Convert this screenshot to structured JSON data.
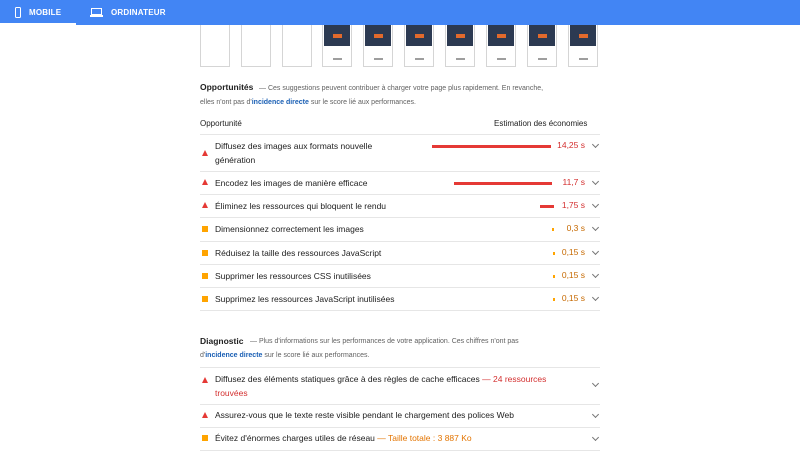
{
  "tabs": {
    "mobile": {
      "label": "MOBILE",
      "icon": "phone-icon"
    },
    "desktop": {
      "label": "ORDINATEUR",
      "icon": "laptop-icon"
    }
  },
  "colors": {
    "header": "#4285f4",
    "fail": "#e53935",
    "average": "#ffa400"
  },
  "opportunities": {
    "title": "Opportunités",
    "desc_1": "— Ces suggestions peuvent contribuer à charger votre page plus rapidement. En revanche,",
    "desc_2a": "elles n'ont pas d'",
    "desc_link": "incidence directe",
    "desc_2b": " sur le score lié aux performances.",
    "col_opportunity": "Opportunité",
    "col_savings": "Estimation des économies",
    "items": [
      {
        "label": "Diffusez des images aux formats nouvelle génération",
        "value": "14,25 s",
        "status": "fail",
        "savings_s": 14.25
      },
      {
        "label": "Encodez les images de manière efficace",
        "value": "11,7 s",
        "status": "fail",
        "savings_s": 11.7
      },
      {
        "label": "Éliminez les ressources qui bloquent le rendu",
        "value": "1,75 s",
        "status": "fail",
        "savings_s": 1.75
      },
      {
        "label": "Dimensionnez correctement les images",
        "value": "0,3 s",
        "status": "average",
        "savings_s": 0.3
      },
      {
        "label": "Réduisez la taille des ressources JavaScript",
        "value": "0,15 s",
        "status": "average",
        "savings_s": 0.15
      },
      {
        "label": "Supprimer les ressources CSS inutilisées",
        "value": "0,15 s",
        "status": "average",
        "savings_s": 0.15
      },
      {
        "label": "Supprimez les ressources JavaScript inutilisées",
        "value": "0,15 s",
        "status": "average",
        "savings_s": 0.15
      }
    ]
  },
  "diagnostic": {
    "title": "Diagnostic",
    "desc_1": "— Plus d'informations sur les performances de votre application. Ces chiffres n'ont pas",
    "desc_2a": "d'",
    "desc_link": "incidence directe",
    "desc_2b": " sur le score lié aux performances.",
    "items": [
      {
        "label": "Diffusez des éléments statiques grâce à des règles de cache efficaces",
        "detail": "— 24 ressources trouvées",
        "status": "fail"
      },
      {
        "label": "Assurez-vous que le texte reste visible pendant le chargement des polices Web",
        "detail": "",
        "status": "fail"
      },
      {
        "label": "Évitez d'énormes charges utiles de réseau",
        "detail": "— Taille totale : 3 887 Ko",
        "status": "average"
      }
    ]
  }
}
